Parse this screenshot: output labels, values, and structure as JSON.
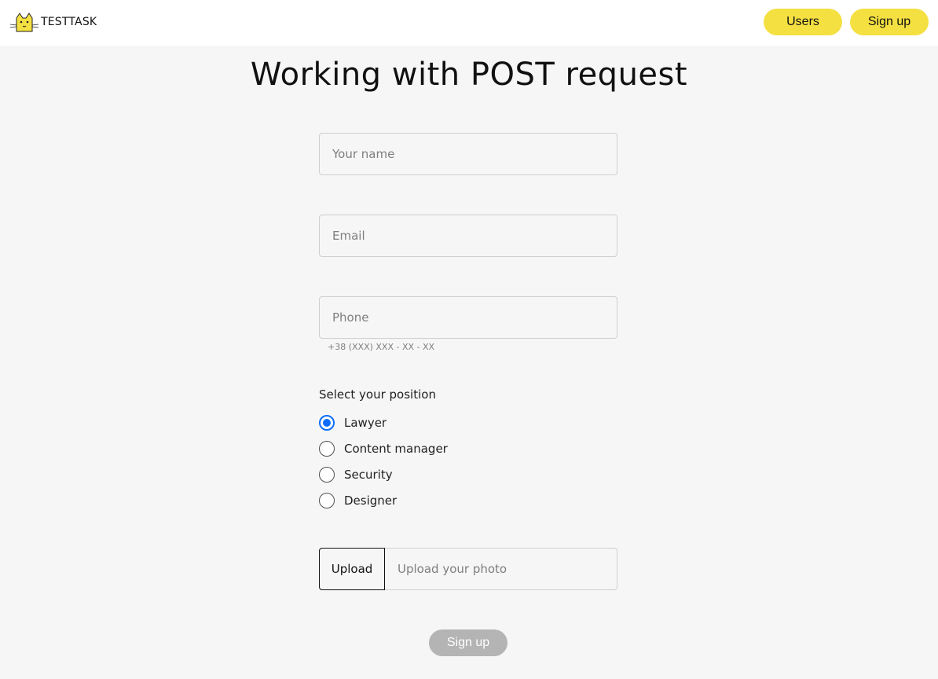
{
  "header": {
    "logo_text": "TESTTASK",
    "logo_icon": "cat-logo-icon",
    "nav": {
      "users_label": "Users",
      "signup_label": "Sign up"
    }
  },
  "main": {
    "title": "Working with POST request",
    "form": {
      "name_placeholder": "Your name",
      "email_placeholder": "Email",
      "phone_placeholder": "Phone",
      "phone_helper": "+38 (XXX) XXX - XX - XX",
      "position_label": "Select your position",
      "positions": [
        {
          "label": "Lawyer",
          "checked": true
        },
        {
          "label": "Content manager",
          "checked": false
        },
        {
          "label": "Security",
          "checked": false
        },
        {
          "label": "Designer",
          "checked": false
        }
      ],
      "upload_button_label": "Upload",
      "upload_placeholder": "Upload your photo",
      "submit_label": "Sign up"
    }
  },
  "colors": {
    "accent": "#f4e041",
    "background": "#f6f6f6",
    "radio_checked": "#0d6efd",
    "disabled_button": "#b4b4b4"
  }
}
